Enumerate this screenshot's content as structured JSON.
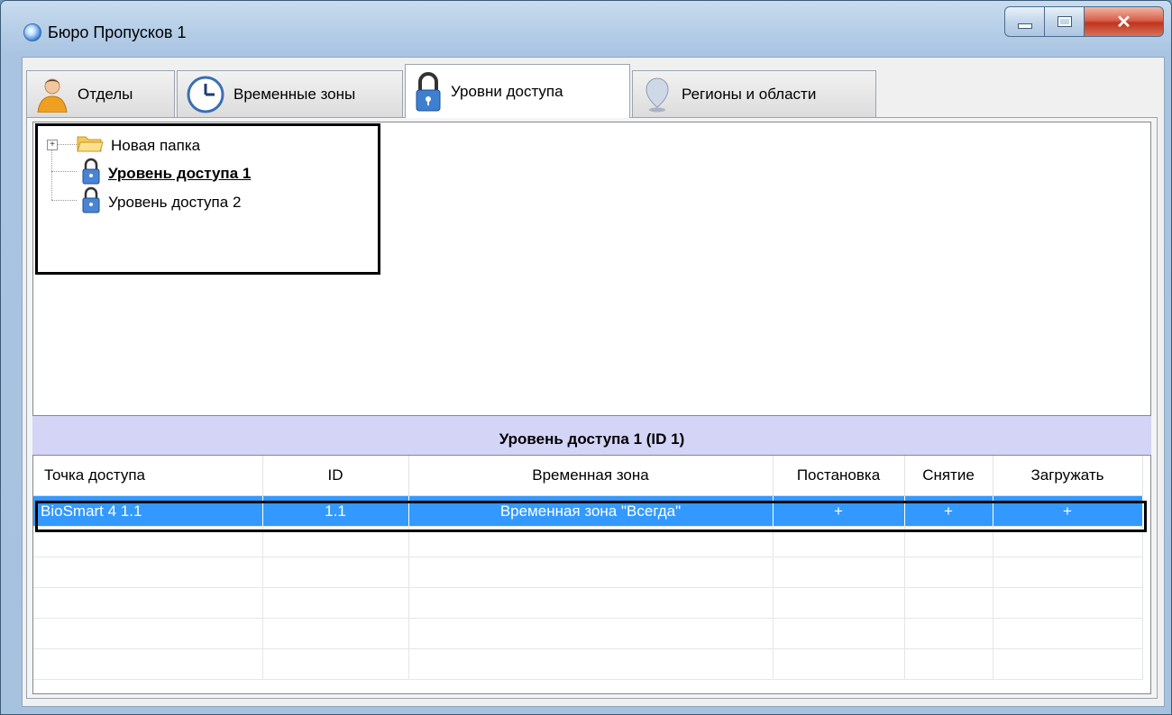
{
  "window": {
    "title": "Бюро Пропусков 1"
  },
  "tabs": [
    {
      "label": "Отделы",
      "icon": "person-icon",
      "active": false
    },
    {
      "label": "Временные зоны",
      "icon": "clock-icon",
      "active": false
    },
    {
      "label": "Уровни доступа",
      "icon": "lock-icon",
      "active": true
    },
    {
      "label": "Регионы и области",
      "icon": "map-pin-icon",
      "active": false
    }
  ],
  "tree": {
    "items": [
      {
        "label": "Новая папка",
        "type": "folder",
        "expander": "+"
      },
      {
        "label": "Уровень доступа 1",
        "type": "access-level",
        "selected": true
      },
      {
        "label": "Уровень доступа 2",
        "type": "access-level",
        "selected": false
      }
    ]
  },
  "grid": {
    "title": "Уровень доступа 1 (ID 1)",
    "columns": [
      "Точка доступа",
      "ID",
      "Временная зона",
      "Постановка",
      "Снятие",
      "Загружать"
    ],
    "rows": [
      [
        "BioSmart 4 1.1",
        "1.1",
        "Временная зона \"Всегда\"",
        "+",
        "+",
        "+"
      ]
    ]
  },
  "colors": {
    "selection": "#3399ff",
    "grid_title_bg": "#d4d4f7",
    "close_button": "#c0341c"
  }
}
